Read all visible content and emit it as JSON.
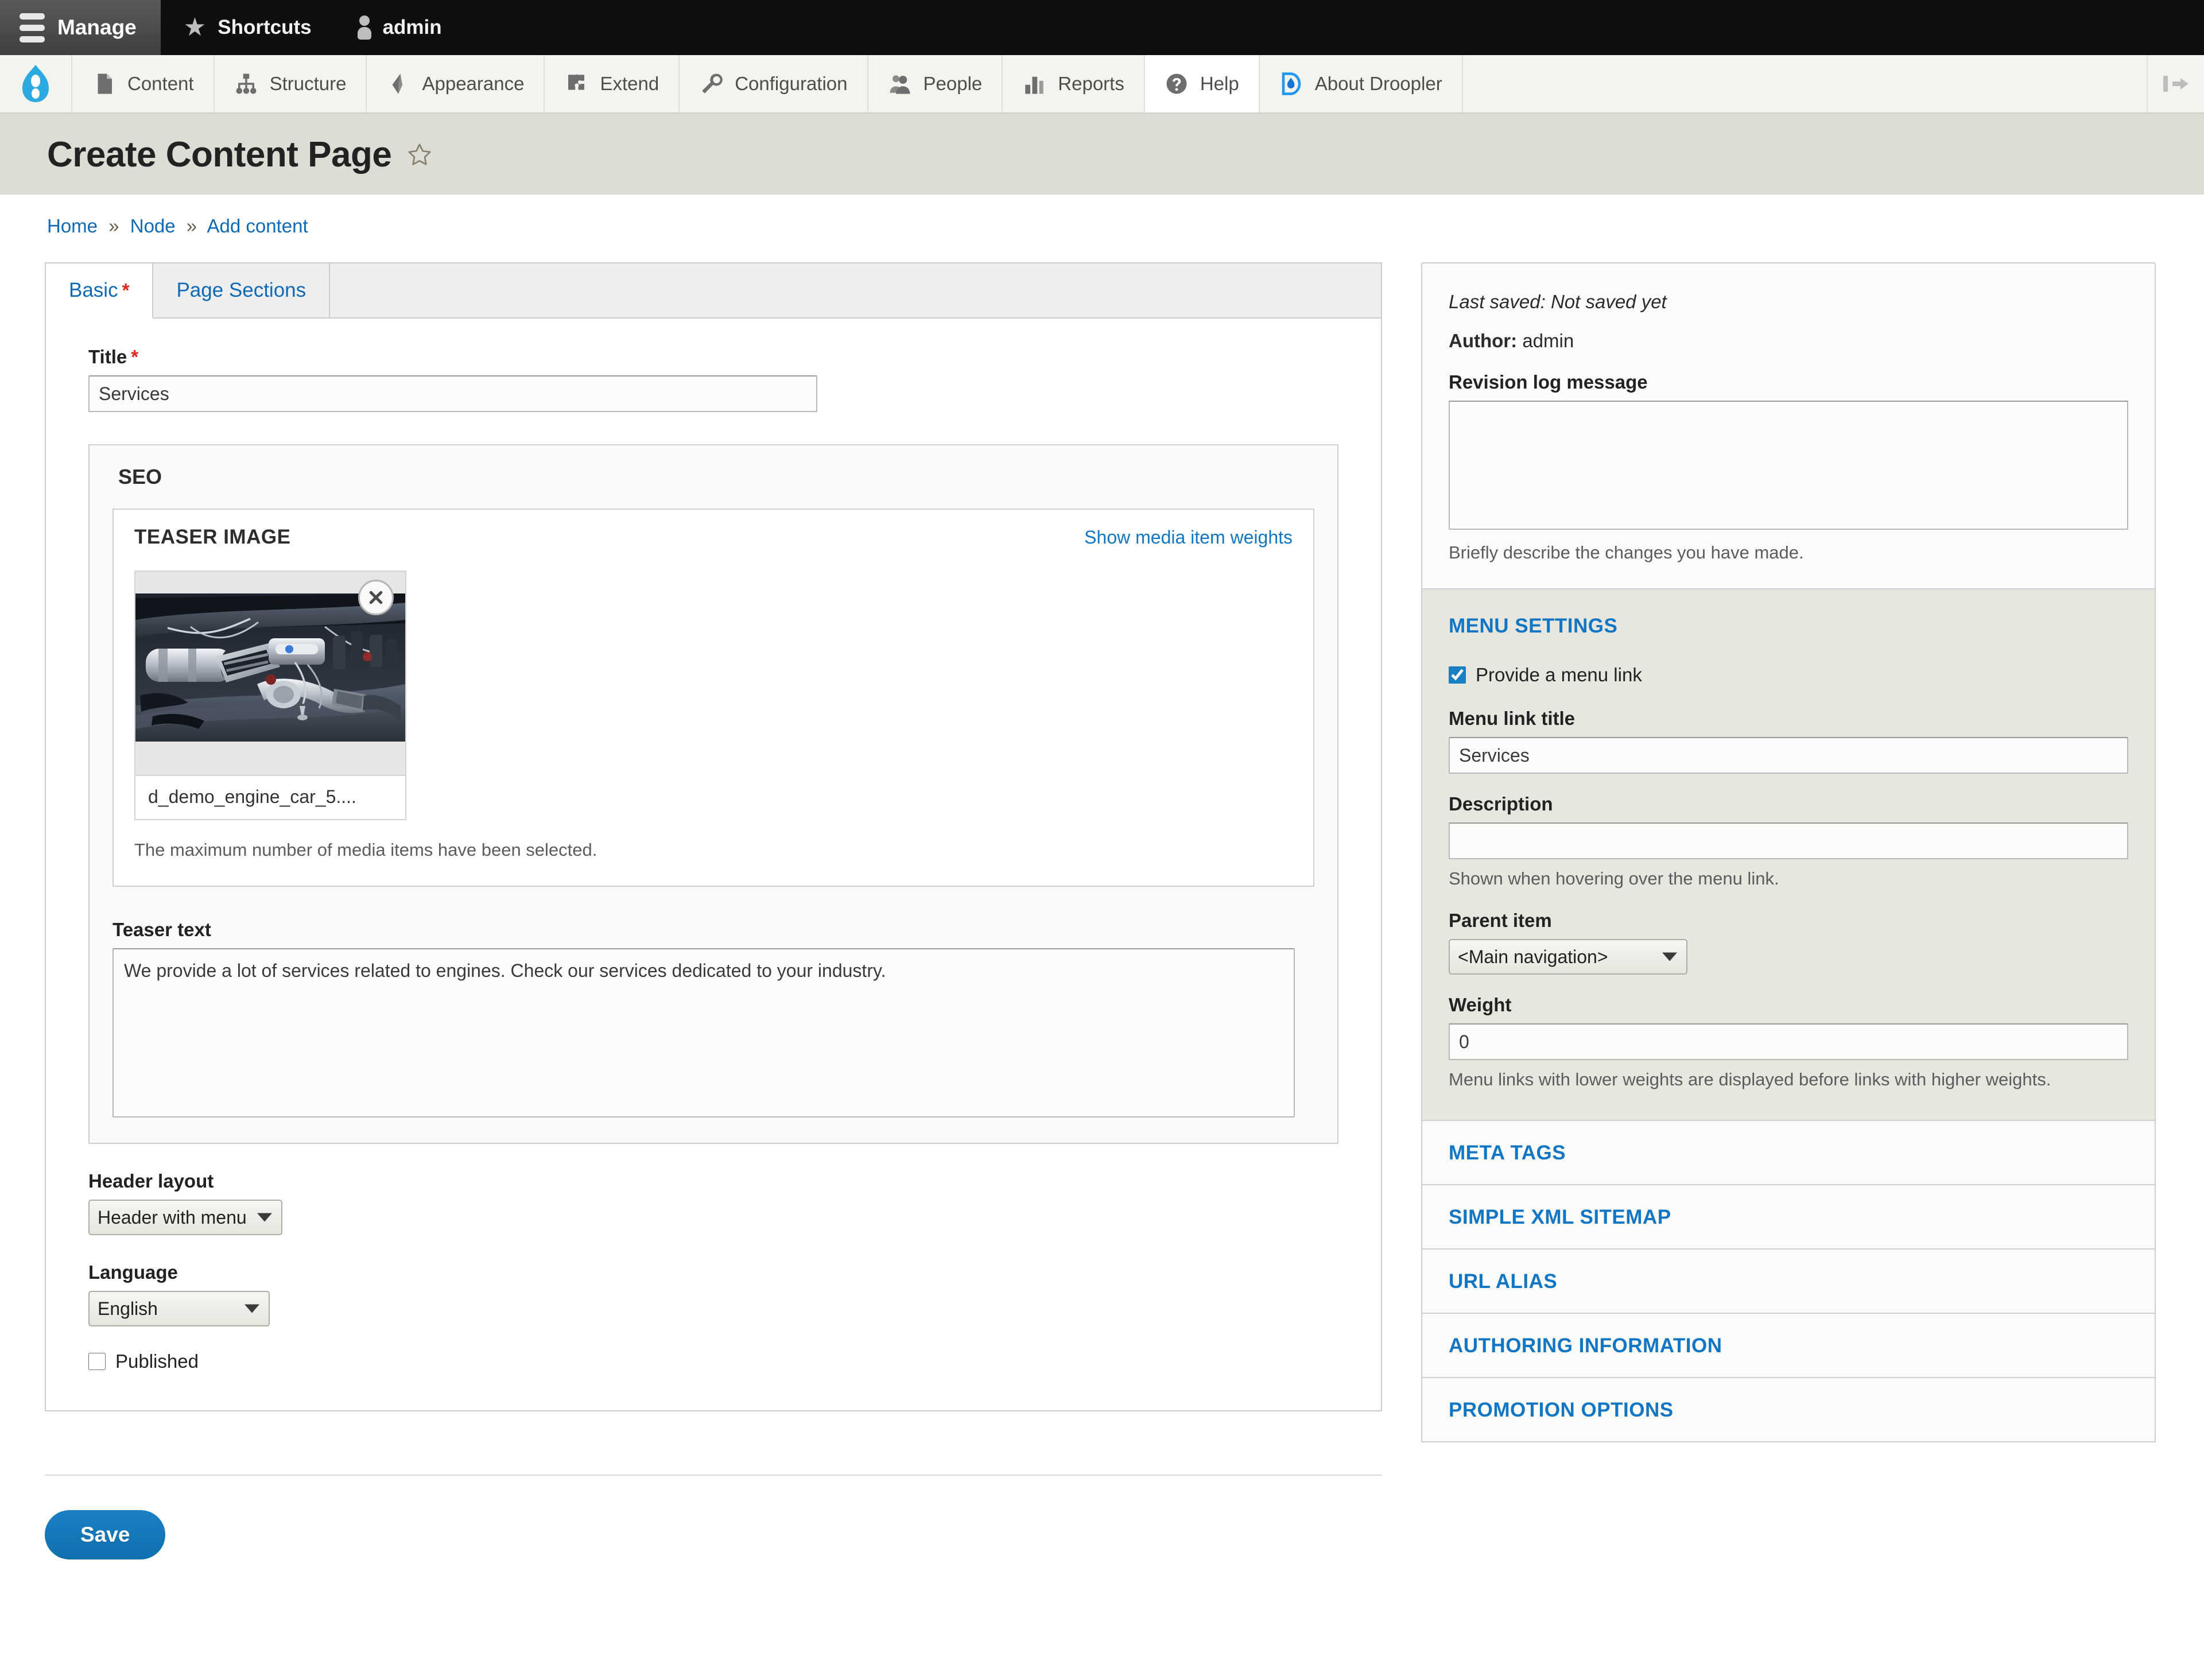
{
  "toolbar": {
    "manage": "Manage",
    "shortcuts": "Shortcuts",
    "user": "admin"
  },
  "adminmenu": {
    "items": [
      {
        "label": "Content",
        "icon": "content-page-icon"
      },
      {
        "label": "Structure",
        "icon": "structure-tree-icon"
      },
      {
        "label": "Appearance",
        "icon": "appearance-brush-icon"
      },
      {
        "label": "Extend",
        "icon": "extend-puzzle-icon"
      },
      {
        "label": "Configuration",
        "icon": "configuration-wrench-icon"
      },
      {
        "label": "People",
        "icon": "people-icon"
      },
      {
        "label": "Reports",
        "icon": "reports-bars-icon"
      },
      {
        "label": "Help",
        "icon": "help-question-icon"
      },
      {
        "label": "About Droopler",
        "icon": "droopler-drop-icon"
      }
    ]
  },
  "header": {
    "title": "Create Content Page",
    "breadcrumb": [
      "Home",
      "Node",
      "Add content"
    ],
    "breadcrumb_separator": "»"
  },
  "tabs": [
    {
      "label": "Basic",
      "required": true,
      "active": true
    },
    {
      "label": "Page Sections",
      "required": false,
      "active": false
    }
  ],
  "form": {
    "title_label": "Title",
    "title_value": "Services",
    "seo_legend": "SEO",
    "media": {
      "legend": "TEASER IMAGE",
      "weights_link": "Show media item weights",
      "item_name": "d_demo_engine_car_5....",
      "max_note": "The maximum number of media items have been selected."
    },
    "teaser_label": "Teaser text",
    "teaser_value": "We provide a lot of services related to engines. Check our services dedicated to your industry.",
    "header_layout_label": "Header layout",
    "header_layout_value": "Header with menu",
    "language_label": "Language",
    "language_value": "English",
    "published_label": "Published",
    "published_checked": false,
    "save_label": "Save"
  },
  "sidebar": {
    "last_saved_label": "Last saved:",
    "last_saved_value": "Not saved yet",
    "author_label": "Author:",
    "author_value": "admin",
    "revision_label": "Revision log message",
    "revision_value": "",
    "revision_help": "Briefly describe the changes you have made.",
    "menu_settings": {
      "title": "MENU SETTINGS",
      "provide_link_label": "Provide a menu link",
      "provide_link_checked": true,
      "menu_title_label": "Menu link title",
      "menu_title_value": "Services",
      "description_label": "Description",
      "description_value": "",
      "description_help": "Shown when hovering over the menu link.",
      "parent_label": "Parent item",
      "parent_value": "<Main navigation>",
      "weight_label": "Weight",
      "weight_value": "0",
      "weight_help": "Menu links with lower weights are displayed before links with higher weights."
    },
    "sections": [
      "META TAGS",
      "SIMPLE XML SITEMAP",
      "URL ALIAS",
      "AUTHORING INFORMATION",
      "PROMOTION OPTIONS"
    ]
  },
  "colors": {
    "link": "#1276c4",
    "accent": "#0f6fae",
    "required": "#e2261c",
    "droopler": "#2196f3"
  }
}
